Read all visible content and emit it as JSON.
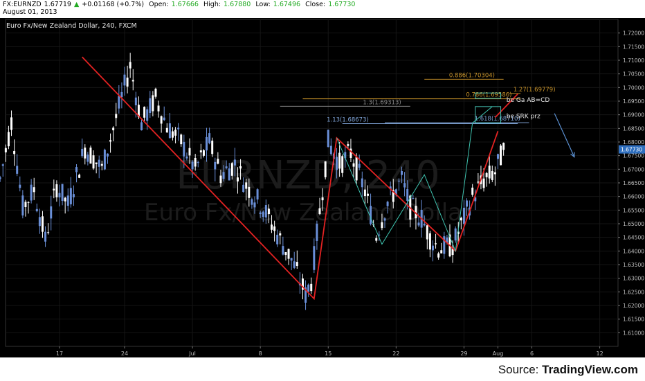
{
  "header": {
    "symbol": "FX:EURNZD",
    "last": "1.67719",
    "change_arrow": "▲",
    "change": "+0.01168 (+0.7%)",
    "open_label": "Open:",
    "open": "1.67666",
    "high_label": "High:",
    "high": "1.67880",
    "low_label": "Low:",
    "low": "1.67496",
    "close_label": "Close:",
    "close": "1.67730",
    "date": "August 01, 2013"
  },
  "footer": {
    "source_prefix": "Source: ",
    "source_brand": "TradingView.com"
  },
  "chart_data": {
    "type": "candlestick",
    "title": "Euro Fx/New Zealand Dollar, 240, FXCM",
    "watermark_symbol": "EURNZD, 240",
    "watermark_name": "Euro Fx/New Zealand Dollar",
    "ylim": [
      1.605,
      1.725
    ],
    "y_ticks": [
      "1.72000",
      "1.71500",
      "1.71000",
      "1.70500",
      "1.70000",
      "1.69500",
      "1.69000",
      "1.68500",
      "1.68000",
      "1.67500",
      "1.67000",
      "1.66500",
      "1.66000",
      "1.65500",
      "1.65000",
      "1.64500",
      "1.64000",
      "1.63500",
      "1.63000",
      "1.62500",
      "1.62000",
      "1.61500",
      "1.61000"
    ],
    "x_ticks": [
      "17",
      "24",
      "Jul",
      "8",
      "15",
      "22",
      "29",
      "Aug",
      "6",
      "12"
    ],
    "x_tick_index": [
      0,
      23,
      47,
      71,
      95,
      119,
      143,
      155,
      167,
      191
    ],
    "bars_total": 200,
    "last_price_label": "1.67730",
    "colors": {
      "up": "#6a8fd8",
      "down": "#ffffff",
      "pattern_red": "#e32222",
      "pattern_teal": "#3fc4b0",
      "fib_orange": "#c8932a",
      "fib_gray": "#8c8c8c",
      "fib_blue": "#7fa3d6",
      "arrow": "#5a8fd0",
      "box": "#46c6b6"
    },
    "path_points": [
      [
        -21,
        1.6665
      ],
      [
        -17,
        1.6875
      ],
      [
        -13,
        1.656
      ],
      [
        -9,
        1.6625
      ],
      [
        -5,
        1.644
      ],
      [
        -1,
        1.664
      ],
      [
        3,
        1.657
      ],
      [
        9,
        1.678
      ],
      [
        15,
        1.67
      ],
      [
        19,
        1.685
      ],
      [
        25,
        1.708
      ],
      [
        29,
        1.687
      ],
      [
        34,
        1.696
      ],
      [
        38,
        1.686
      ],
      [
        43,
        1.68
      ],
      [
        48,
        1.67
      ],
      [
        53,
        1.68
      ],
      [
        57,
        1.668
      ],
      [
        62,
        1.672
      ],
      [
        66,
        1.664
      ],
      [
        72,
        1.656
      ],
      [
        78,
        1.644
      ],
      [
        82,
        1.637
      ],
      [
        87,
        1.624
      ],
      [
        89,
        1.629
      ],
      [
        91,
        1.646
      ],
      [
        95,
        1.68
      ],
      [
        99,
        1.672
      ],
      [
        103,
        1.676
      ],
      [
        108,
        1.662
      ],
      [
        112,
        1.646
      ],
      [
        116,
        1.658
      ],
      [
        121,
        1.666
      ],
      [
        124,
        1.656
      ],
      [
        128,
        1.652
      ],
      [
        131,
        1.645
      ],
      [
        134,
        1.641
      ],
      [
        139,
        1.642
      ],
      [
        143,
        1.652
      ],
      [
        146,
        1.66
      ],
      [
        150,
        1.666
      ],
      [
        154,
        1.669
      ],
      [
        157,
        1.6771
      ]
    ],
    "patterns": [
      {
        "name": "red-zigzag",
        "color": "red",
        "points": [
          [
            8,
            1.7112
          ],
          [
            90,
            1.6225
          ],
          [
            98,
            1.6815
          ],
          [
            140,
            1.64
          ],
          [
            155,
            1.684
          ]
        ]
      },
      {
        "name": "teal-zigzag",
        "color": "teal",
        "points": [
          [
            98,
            1.6815
          ],
          [
            114,
            1.6425
          ],
          [
            129,
            1.668
          ],
          [
            140,
            1.64
          ],
          [
            146,
            1.687
          ],
          [
            153,
            1.693
          ]
        ]
      },
      {
        "name": "red-extension",
        "color": "red",
        "points": [
          [
            154,
            1.689
          ],
          [
            162,
            1.6976
          ]
        ]
      }
    ],
    "fib_levels": [
      {
        "label": "0.886(1.70304)",
        "value": 1.70304,
        "x0": 129,
        "x1": 157,
        "color": "orange"
      },
      {
        "label": "0.786(1.69586)",
        "value": 1.69586,
        "x0": 86,
        "x1": 163,
        "color": "orange"
      },
      {
        "label": "1.3(1.69313)",
        "value": 1.69313,
        "x0": 78,
        "x1": 124,
        "color": "gray"
      },
      {
        "label": "1.27(1.69779)",
        "value": 1.69779,
        "x0": 159,
        "x1": 163,
        "color": "orange"
      },
      {
        "label": "1.13(1.68673)",
        "value": 1.68673,
        "x0": 100,
        "x1": 162,
        "color": "blue"
      },
      {
        "label": "1.618(1.68710)",
        "value": 1.6871,
        "x0": 115,
        "x1": 166,
        "color": "blue"
      }
    ],
    "boxes": [
      {
        "x0": 147,
        "x1": 156,
        "y0": 1.696,
        "y1": 1.698
      },
      {
        "x0": 147,
        "x1": 156,
        "y0": 1.687,
        "y1": 1.693
      }
    ],
    "annotations": [
      {
        "text": "be Ga AB=CD",
        "x": 158,
        "y": 1.6955
      },
      {
        "text": "be SRK prz",
        "x": 158,
        "y": 1.6895
      }
    ],
    "arrow": {
      "from": [
        175,
        1.6905
      ],
      "to": [
        182,
        1.6745
      ]
    }
  }
}
